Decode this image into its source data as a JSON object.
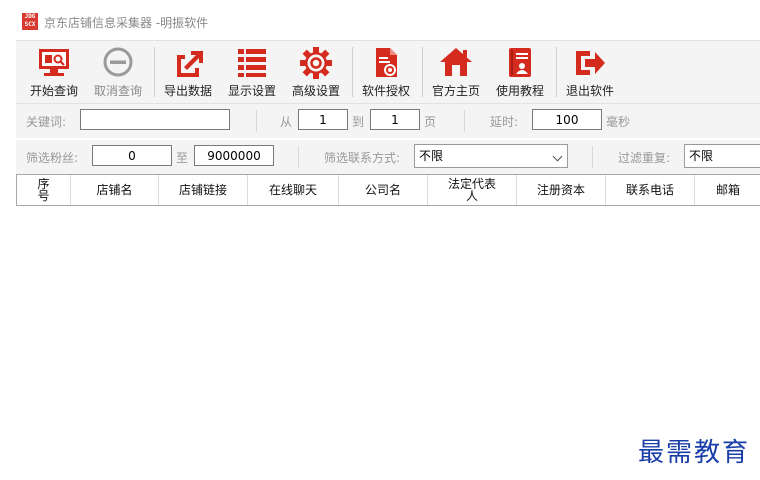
{
  "window": {
    "logo_text": "JDG SCX",
    "title": "京东店铺信息采集器 -明振软件"
  },
  "toolbar": {
    "start": {
      "label": "开始查询",
      "icon": "search-monitor-icon"
    },
    "cancel": {
      "label": "取消查询",
      "icon": "cancel-circle-icon"
    },
    "export": {
      "label": "导出数据",
      "icon": "export-icon"
    },
    "display": {
      "label": "显示设置",
      "icon": "list-icon"
    },
    "advanced": {
      "label": "高级设置",
      "icon": "gear-icon"
    },
    "license": {
      "label": "软件授权",
      "icon": "license-document-icon"
    },
    "homepage": {
      "label": "官方主页",
      "icon": "home-icon"
    },
    "tutorial": {
      "label": "使用教程",
      "icon": "book-icon"
    },
    "exit": {
      "label": "退出软件",
      "icon": "exit-icon"
    },
    "accent_color": "#d42b1e"
  },
  "search": {
    "keyword_label": "关键词:",
    "keyword_value": "",
    "from_label": "从",
    "from_value": "1",
    "to_label": "到",
    "to_value": "1",
    "page_label": "页",
    "delay_label": "延时:",
    "delay_value": "100",
    "ms_label": "毫秒"
  },
  "filter": {
    "fans_label": "筛选粉丝:",
    "fans_min": "0",
    "range_label": "至",
    "fans_max": "9000000",
    "contact_label": "筛选联系方式:",
    "contact_value": "不限",
    "dedup_label": "过滤重复:",
    "dedup_value": "不限"
  },
  "table": {
    "columns": [
      "序号",
      "店铺名",
      "店铺链接",
      "在线聊天",
      "公司名",
      "法定代表人",
      "注册资本",
      "联系电话",
      "邮箱"
    ]
  },
  "watermark": "最需教育"
}
